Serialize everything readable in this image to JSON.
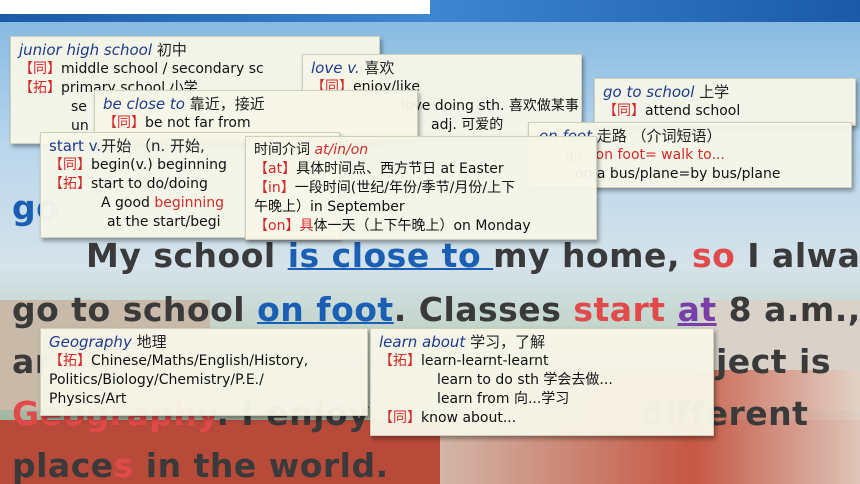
{
  "passage": {
    "line0": "go",
    "line1": {
      "a": "My school ",
      "b": "is close to ",
      "c": "my home, ",
      "d": "so",
      "e": " I always"
    },
    "line2": {
      "a": "go to school ",
      "b": "on foot",
      "c": ". Classes ",
      "d": "start",
      "e": " ",
      "f": "at",
      "g": " 8 a.m.,"
    },
    "line3": {
      "a": "ar",
      "b": "ject is"
    },
    "line4": {
      "a": "Geography",
      "b": ". I enjoy ",
      "c": "different"
    },
    "line5": {
      "a": "place",
      "b": "s",
      "c": " in the world."
    }
  },
  "cards": {
    "junior": {
      "title": "junior high school",
      "title_zh": "初中",
      "tag1": "【同】",
      "l1": "middle school / secondary sc",
      "tag2": "【拓】",
      "l2": "primary school 小学",
      "l3": "se",
      "l4": "un"
    },
    "love": {
      "title": "love v.",
      "title_zh": "喜欢",
      "tag1": "【同】",
      "l1": "enjoy/like",
      "l2": "love doing sth. 喜欢做某事",
      "l3": "adj. 可爱的"
    },
    "goto": {
      "title": "go to school",
      "title_zh": "上学",
      "tag1": "【同】",
      "l1": "attend school"
    },
    "foot": {
      "title": "on foot",
      "title_zh": "走路 （介词短语）",
      "l1": "go...on foot= walk to...",
      "l2": "on a bus/plane=by bus/plane"
    },
    "close": {
      "title": "be close to",
      "title_zh": "靠近，接近",
      "tag1": "【同】",
      "l1": "be not far from"
    },
    "start": {
      "title": "start v.",
      "title_zh": "开始 （n. 开始,",
      "tag1": "【同】",
      "l1": "begin(v.) beginning",
      "tag2": "【拓】",
      "l2": "start to do/doing",
      "l3a": "A good ",
      "l3b": "beginning",
      "l4": "at the start/begi"
    },
    "time": {
      "title_zh": "时间介词",
      "title": "at/in/on",
      "tag1": "【at】",
      "l1": "具体时间点、西方节日 at Easter",
      "tag2": "【in】",
      "l2": "一段时间(世纪/年份/季节/月份/上下",
      "l3": "午晚上）in September",
      "tag3": "【on】",
      "l4a": "具",
      "l4b": "体一天（上下午晚上）on Monday"
    },
    "geo": {
      "title": "Geography",
      "title_zh": "地理",
      "tag1": "【拓】",
      "l1": "Chinese/Maths/English/History,",
      "l2": "Politics/Biology/Chemistry/P.E./",
      "l3": "Physics/Art"
    },
    "learn": {
      "title": "learn about",
      "title_zh": "学习，了解",
      "tag1": "【拓】",
      "l1": "learn-learnt-learnt",
      "l2": "learn to do sth 学会去做...",
      "l3": "learn from 向...学习",
      "tag2": "【同】",
      "l4": "know about..."
    }
  }
}
